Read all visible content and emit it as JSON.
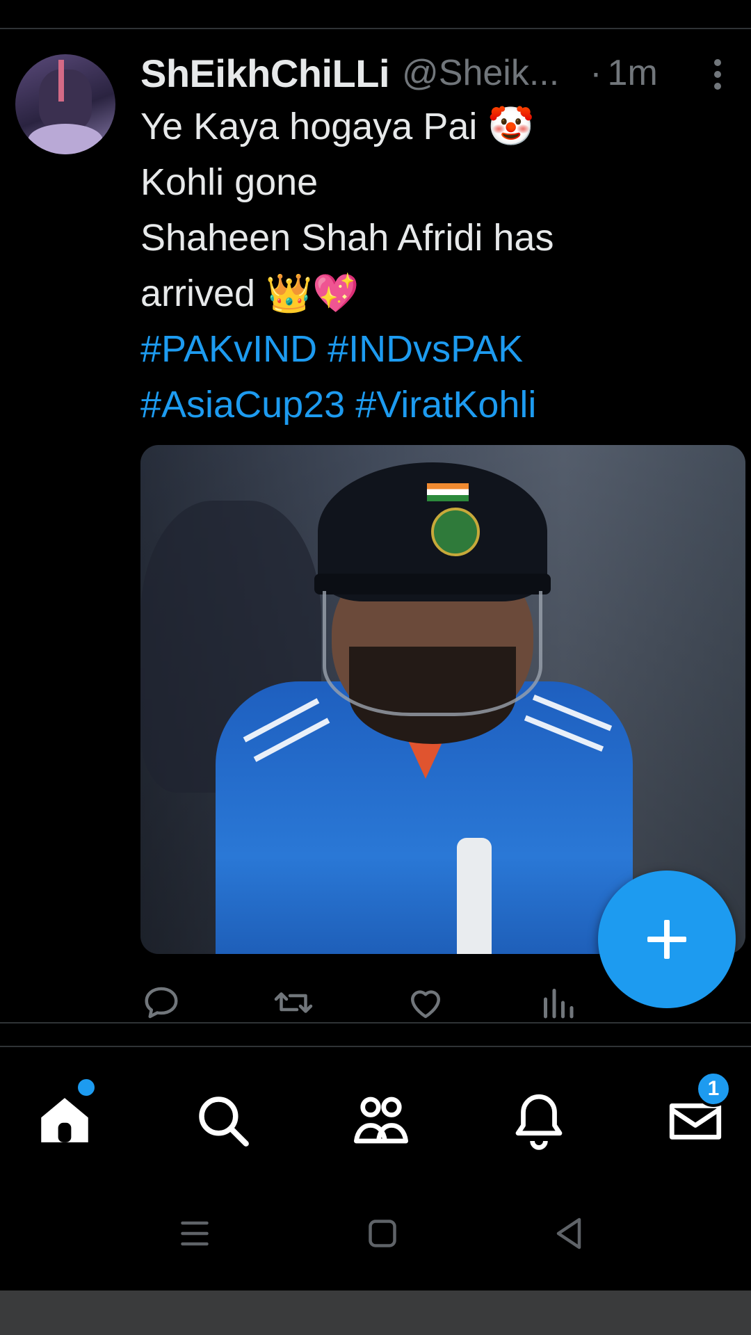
{
  "tweet": {
    "display_name": "ShEikhChiLLi",
    "handle": "@Sheik...",
    "separator": "·",
    "time": "1m",
    "text_lines": [
      "Ye Kaya hogaya Pai 🤡",
      "Kohli gone",
      "Shaheen Shah Afridi has",
      "arrived 👑💖"
    ],
    "hashtag_lines": [
      [
        "#PAKvIND",
        "#INDvsPAK"
      ],
      [
        "#AsiaCup23",
        "#ViratKohli"
      ]
    ]
  },
  "actions": [
    {
      "icon": "reply-icon"
    },
    {
      "icon": "retweet-icon"
    },
    {
      "icon": "like-icon"
    },
    {
      "icon": "views-icon"
    }
  ],
  "fab": {
    "icon": "plus-icon"
  },
  "bottom_nav": {
    "items": [
      "home-icon",
      "search-icon",
      "communities-icon",
      "notifications-icon",
      "messages-icon"
    ],
    "messages_badge": "1"
  },
  "system_nav": [
    "recents-icon",
    "home-button-icon",
    "back-icon"
  ],
  "colors": {
    "background": "#000000",
    "text": "#e7e9ea",
    "muted": "#71767b",
    "accent": "#1d9bf0"
  }
}
